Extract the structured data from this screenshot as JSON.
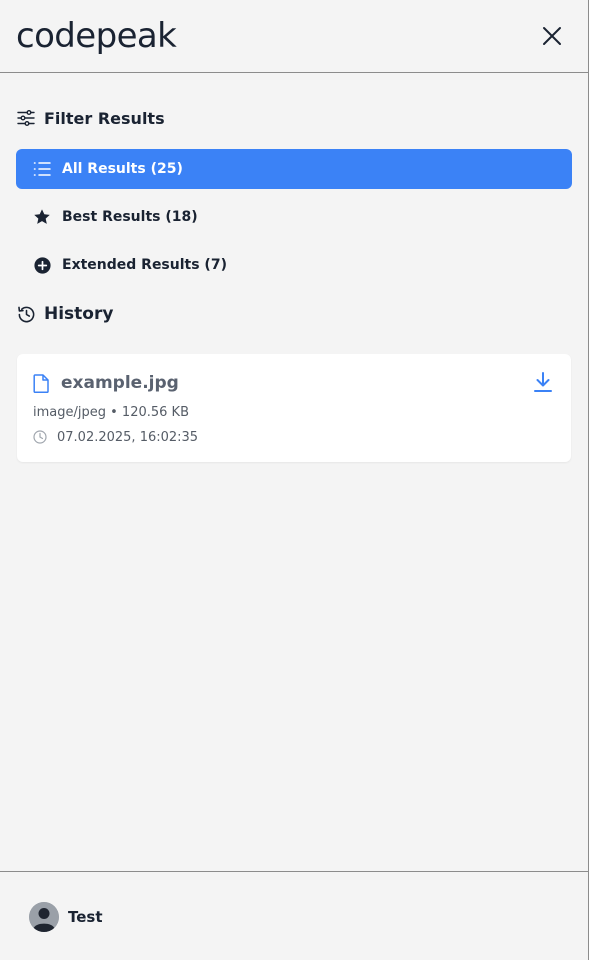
{
  "brand": "codepeak",
  "filter": {
    "title": "Filter Results",
    "items": [
      {
        "label": "All Results (25)",
        "icon": "list-icon",
        "active": true
      },
      {
        "label": "Best Results (18)",
        "icon": "star-icon",
        "active": false
      },
      {
        "label": "Extended Results (7)",
        "icon": "plus-circle-icon",
        "active": false
      }
    ]
  },
  "history": {
    "title": "History",
    "entries": [
      {
        "filename": "example.jpg",
        "meta": "image/jpeg • 120.56 KB",
        "timestamp": "07.02.2025, 16:02:35"
      }
    ]
  },
  "user": {
    "name": "Test"
  },
  "colors": {
    "accent": "#3b82f6",
    "background": "#f4f4f4",
    "text": "#1a2332"
  }
}
